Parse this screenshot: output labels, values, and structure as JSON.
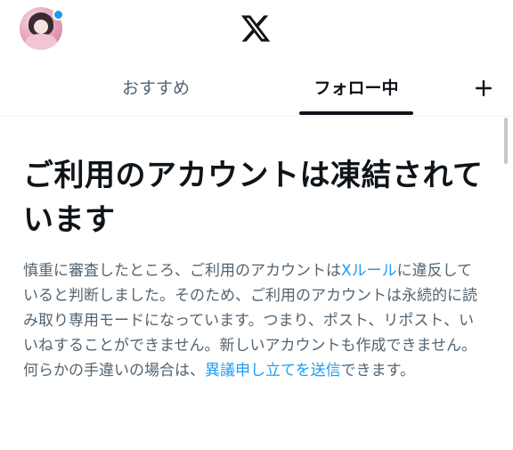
{
  "header": {
    "logo_icon": "x-logo-icon",
    "avatar_badge_color": "#1d9bf0"
  },
  "tabs": [
    {
      "label": "おすすめ",
      "active": false
    },
    {
      "label": "フォロー中",
      "active": true
    }
  ],
  "add_tab_icon": "plus-icon",
  "notice": {
    "headline": "ご利用のアカウントは凍結されています",
    "body_before_link1": "慎重に審査したところ、ご利用のアカウントは",
    "link1": "Xルール",
    "body_between_links": "に違反していると判断しました。そのため、ご利用のアカウントは永続的に読み取り専用モードになっています。つまり、ポスト、リポスト、いいねすることができません。新しいアカウントも作成できません。何らかの手違いの場合は、",
    "link2": "異議申し立てを送信",
    "body_after_link2": "できます。"
  },
  "colors": {
    "link": "#1d9bf0",
    "text_primary": "#0f1419",
    "text_secondary": "#536471"
  }
}
